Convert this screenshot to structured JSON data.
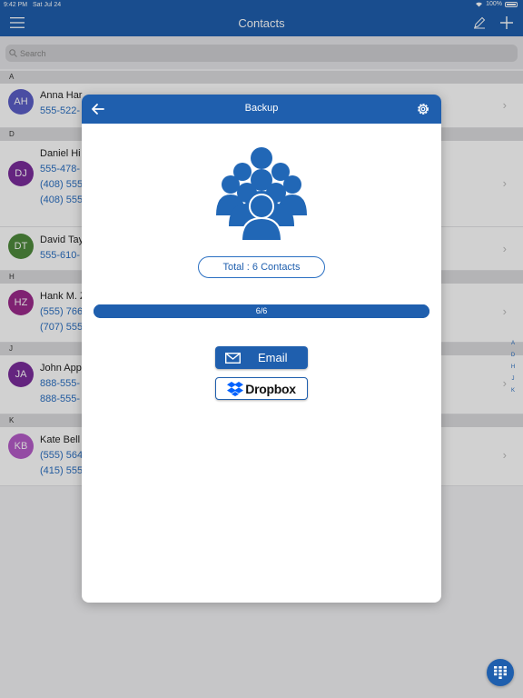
{
  "status_bar": {
    "time": "9:42 PM",
    "date": "Sat Jul 24",
    "battery": "100%"
  },
  "nav": {
    "title": "Contacts",
    "menu_icon": "menu-icon",
    "edit_icon": "pencil-icon",
    "add_icon": "plus-icon"
  },
  "search": {
    "placeholder": "Search"
  },
  "sections": [
    {
      "letter": "A",
      "contacts": [
        {
          "initials": "AH",
          "name": "Anna Har",
          "phones": [
            "555-522-"
          ],
          "color": "#5b5fc7"
        }
      ]
    },
    {
      "letter": "D",
      "contacts": [
        {
          "initials": "DJ",
          "name": "Daniel Hi",
          "phones": [
            "555-478-",
            "(408) 555",
            "(408) 555"
          ],
          "color": "#7b2d9c"
        },
        {
          "initials": "DT",
          "name": "David Tay",
          "phones": [
            "555-610-"
          ],
          "color": "#4f8a3c"
        }
      ]
    },
    {
      "letter": "H",
      "contacts": [
        {
          "initials": "HZ",
          "name": "Hank M. Z",
          "phones": [
            "(555) 766",
            "(707) 555"
          ],
          "color": "#9c2a8c"
        }
      ]
    },
    {
      "letter": "J",
      "contacts": [
        {
          "initials": "JA",
          "name": "John App",
          "phones": [
            "888-555-",
            "888-555-"
          ],
          "color": "#7b2d9c"
        }
      ]
    },
    {
      "letter": "K",
      "contacts": [
        {
          "initials": "KB",
          "name": "Kate Bell",
          "phones": [
            "(555) 564",
            "(415) 555"
          ],
          "color": "#b55cc9"
        }
      ]
    }
  ],
  "index_letters": [
    "A",
    "D",
    "H",
    "J",
    "K"
  ],
  "modal": {
    "title": "Backup",
    "back_icon": "arrow-left-icon",
    "settings_icon": "gear-icon",
    "illustration": "contacts-group-icon",
    "total_label": "Total : 6 Contacts",
    "progress": {
      "text": "6/6",
      "fraction": 1.0
    },
    "email_button": "Email",
    "dropbox_button": "Dropbox"
  },
  "fab_icon": "keypad-icon",
  "colors": {
    "primary": "#1f5fae",
    "link": "#2a6fc2"
  }
}
